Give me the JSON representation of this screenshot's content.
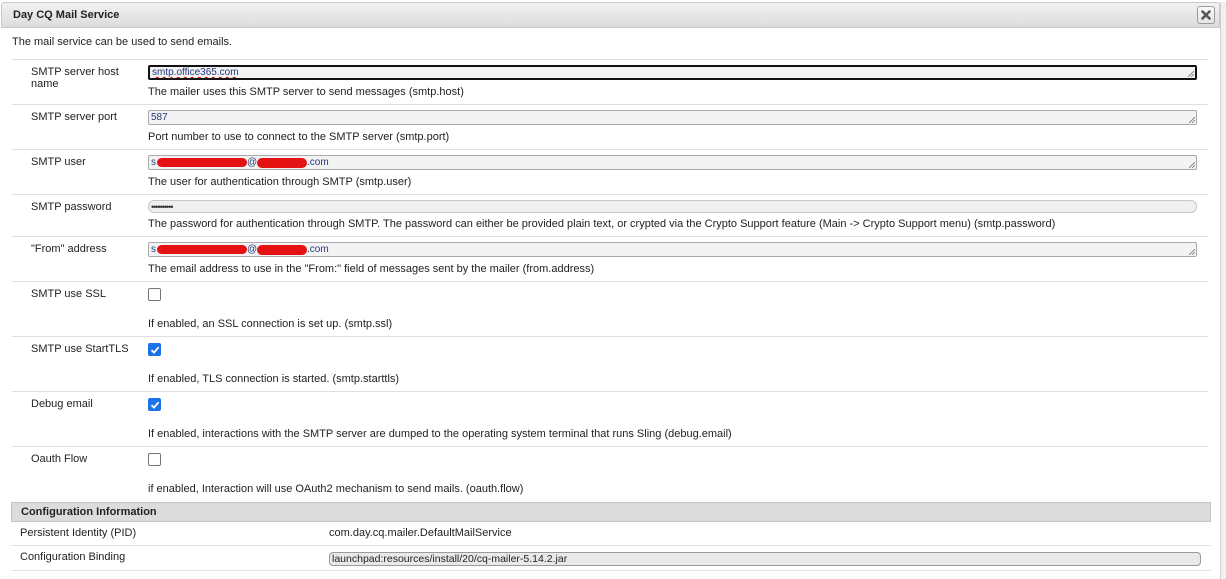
{
  "dialog": {
    "title": "Day CQ Mail Service",
    "intro": "The mail service can be used to send emails."
  },
  "fields": {
    "smtp_host": {
      "label": "SMTP server host name",
      "value": "smtp.office365.com",
      "desc": "The mailer uses this SMTP server to send messages (smtp.host)"
    },
    "smtp_port": {
      "label": "SMTP server port",
      "value": "587",
      "desc": "Port number to use to connect to the SMTP server (smtp.port)"
    },
    "smtp_user": {
      "label": "SMTP user",
      "value_prefix": "s",
      "value_at": "@",
      "value_suffix": ".com",
      "desc": "The user for authentication through SMTP (smtp.user)"
    },
    "smtp_password": {
      "label": "SMTP password",
      "value": "••••••••••",
      "desc": "The password for authentication through SMTP. The password can either be provided plain text, or crypted via the Crypto Support feature (Main -> Crypto Support menu) (smtp.password)"
    },
    "from_address": {
      "label": "\"From\" address",
      "value_prefix": "s",
      "value_at": "@",
      "value_suffix": ".com",
      "desc": "The email address to use in the \"From:\" field of messages sent by the mailer (from.address)"
    },
    "smtp_ssl": {
      "label": "SMTP use SSL",
      "checked": false,
      "desc": "If enabled, an SSL connection is set up. (smtp.ssl)"
    },
    "smtp_starttls": {
      "label": "SMTP use StartTLS",
      "checked": true,
      "desc": "If enabled, TLS connection is started. (smtp.starttls)"
    },
    "debug_email": {
      "label": "Debug email",
      "checked": true,
      "desc": "If enabled, interactions with the SMTP server are dumped to the operating system terminal that runs Sling (debug.email)"
    },
    "oauth_flow": {
      "label": "Oauth Flow",
      "checked": false,
      "desc": "if enabled, Interaction will use OAuth2 mechanism to send mails. (oauth.flow)"
    }
  },
  "config_info": {
    "heading": "Configuration Information",
    "pid_label": "Persistent Identity (PID)",
    "pid_value": "com.day.cq.mailer.DefaultMailService",
    "binding_label": "Configuration Binding",
    "binding_value": "launchpad:resources/install/20/cq-mailer-5.14.2.jar"
  },
  "colors": {
    "checkbox_checked": "#1a73e8",
    "redaction": "#e41212",
    "field_text": "#23397a"
  },
  "icons": {
    "close": "close-icon",
    "checkmark": "checkmark-icon",
    "resize": "resize-grip-icon"
  }
}
